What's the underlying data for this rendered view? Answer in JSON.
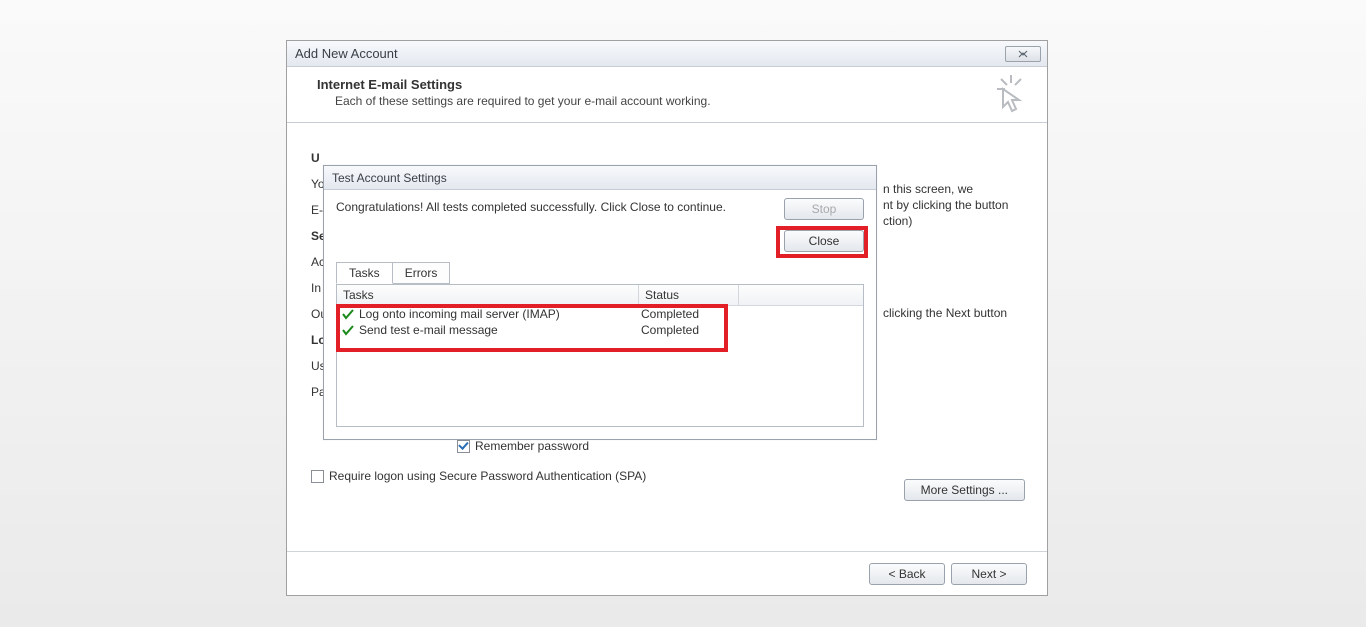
{
  "mainDialog": {
    "title": "Add New Account",
    "headerTitle": "Internet E-mail Settings",
    "headerSubtitle": "Each of these settings are required to get your e-mail account working.",
    "bgLabels": {
      "u": "U",
      "yo": "Yo",
      "e": "E-",
      "s": "Se",
      "a": "Ac",
      "in": "In",
      "ou": "Ou",
      "lo": "Lo",
      "us": "Us",
      "pa": "Pa"
    },
    "rightText": {
      "l1": "n this screen, we",
      "l2": "nt by clicking the button",
      "l3": "ction)",
      "l4": "clicking the Next button"
    },
    "rememberPassword": "Remember password",
    "spa": "Require logon using Secure Password Authentication (SPA)",
    "moreSettings": "More Settings ...",
    "back": "< Back",
    "next": "Next >"
  },
  "testDialog": {
    "title": "Test Account Settings",
    "message": "Congratulations! All tests completed successfully. Click Close to continue.",
    "stop": "Stop",
    "close": "Close",
    "tabs": {
      "tasks": "Tasks",
      "errors": "Errors"
    },
    "columns": {
      "tasks": "Tasks",
      "status": "Status"
    },
    "rows": [
      {
        "name": "Log onto incoming mail server (IMAP)",
        "status": "Completed"
      },
      {
        "name": "Send test e-mail message",
        "status": "Completed"
      }
    ]
  }
}
